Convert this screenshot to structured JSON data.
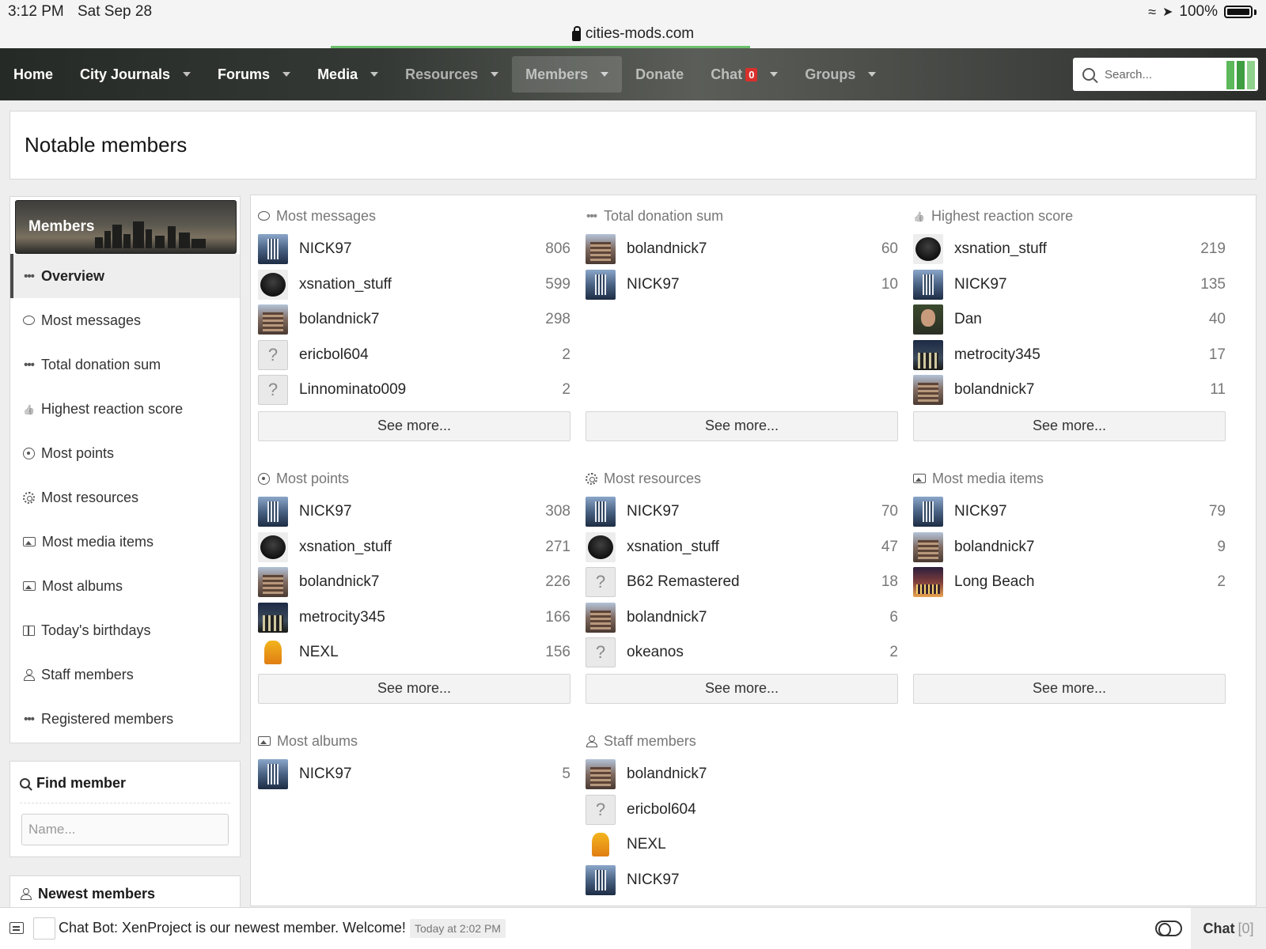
{
  "status": {
    "time": "3:12 PM",
    "date": "Sat Sep 28",
    "battery": "100%"
  },
  "browser": {
    "url": "cities-mods.com"
  },
  "nav": {
    "items": [
      {
        "label": "Home",
        "caret": false
      },
      {
        "label": "City Journals",
        "caret": true
      },
      {
        "label": "Forums",
        "caret": true
      },
      {
        "label": "Media",
        "caret": true
      },
      {
        "label": "Resources",
        "caret": true
      },
      {
        "label": "Members",
        "caret": true
      },
      {
        "label": "Donate",
        "caret": false
      },
      {
        "label": "Chat",
        "caret": true,
        "badge": "0"
      },
      {
        "label": "Groups",
        "caret": true
      }
    ],
    "search_placeholder": "Search..."
  },
  "page": {
    "title": "Notable members"
  },
  "sidebar": {
    "header": "Members",
    "items": [
      {
        "label": "Overview",
        "icon": "dots-icon"
      },
      {
        "label": "Most messages",
        "icon": "bubbles-icon"
      },
      {
        "label": "Total donation sum",
        "icon": "dots-icon"
      },
      {
        "label": "Highest reaction score",
        "icon": "thumbs-up-icon"
      },
      {
        "label": "Most points",
        "icon": "target-icon"
      },
      {
        "label": "Most resources",
        "icon": "gear-icon"
      },
      {
        "label": "Most media items",
        "icon": "media-icon"
      },
      {
        "label": "Most albums",
        "icon": "album-icon"
      },
      {
        "label": "Today's birthdays",
        "icon": "gift-icon"
      },
      {
        "label": "Staff members",
        "icon": "person-icon"
      },
      {
        "label": "Registered members",
        "icon": "dots-icon"
      }
    ]
  },
  "find_member": {
    "title": "Find member",
    "placeholder": "Name..."
  },
  "newest_members": {
    "title": "Newest members"
  },
  "cards": [
    {
      "title": "Most messages",
      "icon": "bubbles-icon",
      "see_more": "See more...",
      "rows": [
        {
          "name": "NICK97",
          "count": "806",
          "avatar": "nick"
        },
        {
          "name": "xsnation_stuff",
          "count": "599",
          "avatar": "xs"
        },
        {
          "name": "bolandnick7",
          "count": "298",
          "avatar": "bola"
        },
        {
          "name": "ericbol604",
          "count": "2",
          "avatar": "q"
        },
        {
          "name": "Linnominato009",
          "count": "2",
          "avatar": "q"
        }
      ]
    },
    {
      "title": "Total donation sum",
      "icon": "dots-icon",
      "see_more": "See more...",
      "rows": [
        {
          "name": "bolandnick7",
          "count": "60",
          "avatar": "bola"
        },
        {
          "name": "NICK97",
          "count": "10",
          "avatar": "nick"
        }
      ]
    },
    {
      "title": "Highest reaction score",
      "icon": "thumbs-up-icon",
      "see_more": "See more...",
      "rows": [
        {
          "name": "xsnation_stuff",
          "count": "219",
          "avatar": "xs"
        },
        {
          "name": "NICK97",
          "count": "135",
          "avatar": "nick"
        },
        {
          "name": "Dan",
          "count": "40",
          "avatar": "dan"
        },
        {
          "name": "metrocity345",
          "count": "17",
          "avatar": "metro"
        },
        {
          "name": "bolandnick7",
          "count": "11",
          "avatar": "bola"
        }
      ]
    },
    {
      "title": "Most points",
      "icon": "target-icon",
      "see_more": "See more...",
      "rows": [
        {
          "name": "NICK97",
          "count": "308",
          "avatar": "nick"
        },
        {
          "name": "xsnation_stuff",
          "count": "271",
          "avatar": "xs"
        },
        {
          "name": "bolandnick7",
          "count": "226",
          "avatar": "bola"
        },
        {
          "name": "metrocity345",
          "count": "166",
          "avatar": "metro"
        },
        {
          "name": "NEXL",
          "count": "156",
          "avatar": "nexl"
        }
      ]
    },
    {
      "title": "Most resources",
      "icon": "gear-icon",
      "see_more": "See more...",
      "rows": [
        {
          "name": "NICK97",
          "count": "70",
          "avatar": "nick"
        },
        {
          "name": "xsnation_stuff",
          "count": "47",
          "avatar": "xs"
        },
        {
          "name": "B62 Remastered",
          "count": "18",
          "avatar": "q"
        },
        {
          "name": "bolandnick7",
          "count": "6",
          "avatar": "bola"
        },
        {
          "name": "okeanos",
          "count": "2",
          "avatar": "q"
        }
      ]
    },
    {
      "title": "Most media items",
      "icon": "media-icon",
      "see_more": "See more...",
      "rows": [
        {
          "name": "NICK97",
          "count": "79",
          "avatar": "nick"
        },
        {
          "name": "bolandnick7",
          "count": "9",
          "avatar": "bola"
        },
        {
          "name": "Long Beach",
          "count": "2",
          "avatar": "lb"
        }
      ]
    },
    {
      "title": "Most albums",
      "icon": "album-icon",
      "see_more": "",
      "rows": [
        {
          "name": "NICK97",
          "count": "5",
          "avatar": "nick"
        }
      ]
    },
    {
      "title": "Staff members",
      "icon": "person-icon",
      "see_more": "",
      "rows": [
        {
          "name": "bolandnick7",
          "count": "",
          "avatar": "bola"
        },
        {
          "name": "ericbol604",
          "count": "",
          "avatar": "q"
        },
        {
          "name": "NEXL",
          "count": "",
          "avatar": "nexl"
        },
        {
          "name": "NICK97",
          "count": "",
          "avatar": "nick"
        }
      ]
    }
  ],
  "chat": {
    "message": "Chat Bot: XenProject is our newest member. Welcome!",
    "time": "Today at 2:02 PM",
    "tab_label": "Chat",
    "tab_count": "[0]"
  }
}
